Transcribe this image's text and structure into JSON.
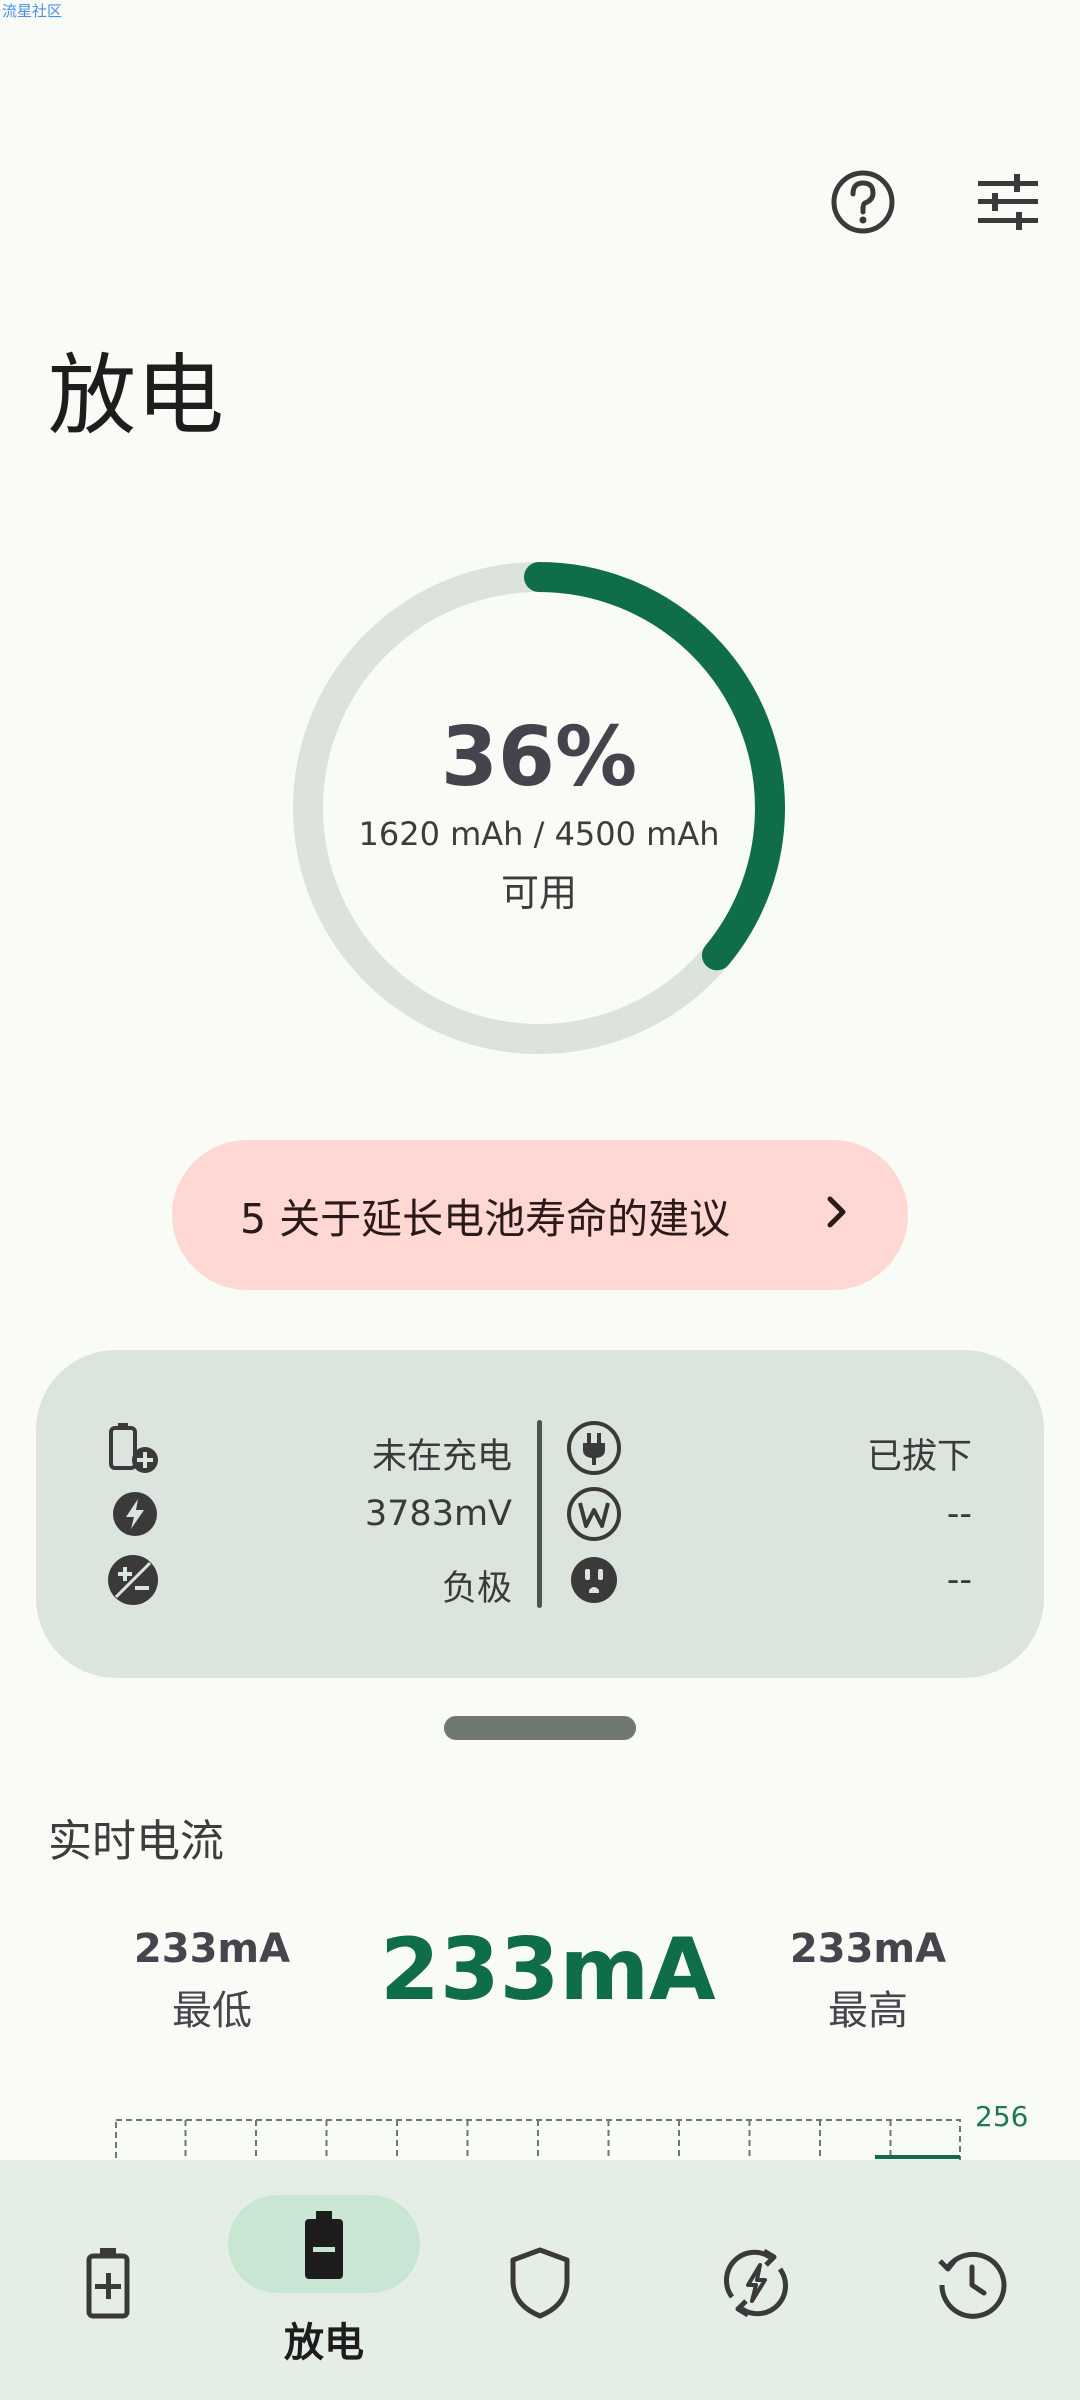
{
  "watermark": "流星社区",
  "header": {
    "title": "放电"
  },
  "battery": {
    "percent": "36%",
    "percent_value": 36,
    "capacity_text": "1620 mAh / 4500 mAh",
    "available_label": "可用"
  },
  "tips": {
    "label": "5 关于延长电池寿命的建议"
  },
  "info": {
    "left": [
      {
        "icon": "battery-plus-icon",
        "value": "未在充电"
      },
      {
        "icon": "bolt-icon",
        "value": "3783mV"
      },
      {
        "icon": "plus-minus-icon",
        "value": "负极"
      }
    ],
    "right": [
      {
        "icon": "plug-icon",
        "value": "已拔下"
      },
      {
        "icon": "watt-icon",
        "value": "--"
      },
      {
        "icon": "outlet-icon",
        "value": "--"
      }
    ]
  },
  "current": {
    "section_title": "实时电流",
    "min_value": "233mA",
    "min_label": "最低",
    "now_value": "233mA",
    "max_value": "233mA",
    "max_label": "最高",
    "graph_max": "256"
  },
  "nav": {
    "active_label": "放电"
  },
  "colors": {
    "accent": "#0f6e47",
    "ring_bg": "#dbe3dc",
    "tips_bg": "#ffd8d4"
  }
}
